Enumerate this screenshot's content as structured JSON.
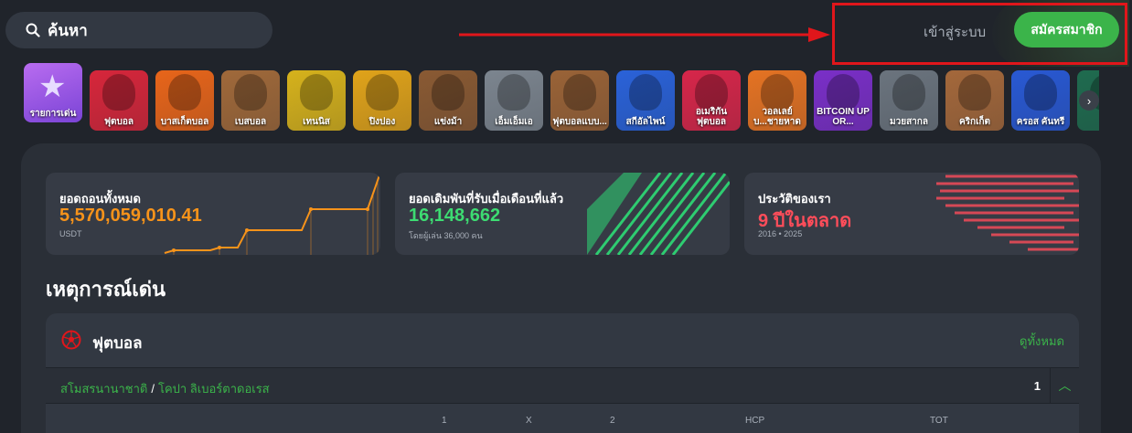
{
  "search": {
    "placeholder": "ค้นหา"
  },
  "auth": {
    "login": "เข้าสู่ระบบ",
    "signup": "สมัครสมาชิก"
  },
  "colors": {
    "accent": "#3bb44a",
    "highlight": "#e0161b",
    "orange": "#f7931a",
    "red": "#ff4d5a"
  },
  "categories": [
    {
      "label": "รายการเด่น",
      "bg": "#9c5ee8"
    },
    {
      "label": "ฟุตบอล",
      "bg": "#d7263b"
    },
    {
      "label": "บาสเก็ตบอล",
      "bg": "#e8651a"
    },
    {
      "label": "เบสบอล",
      "bg": "#a0693a"
    },
    {
      "label": "เทนนิส",
      "bg": "#d6b21c"
    },
    {
      "label": "ปิงปอง",
      "bg": "#e0a31a"
    },
    {
      "label": "แข่งม้า",
      "bg": "#8a5a33"
    },
    {
      "label": "เอ็มเอ็มเอ",
      "bg": "#7c858f"
    },
    {
      "label": "ฟุตบอลแบบ...",
      "bg": "#9a6337"
    },
    {
      "label": "สกีอัลไพน์",
      "bg": "#2a62d9"
    },
    {
      "label": "อเมริกันฟุตบอล",
      "bg": "#d7264a"
    },
    {
      "label": "วอลเลย์บ...ชายหาด",
      "bg": "#e57323"
    },
    {
      "label": "BITCOIN UP OR...",
      "bg": "#7a2fc8"
    },
    {
      "label": "มวยสากล",
      "bg": "#6b747e"
    },
    {
      "label": "คริกเก็ต",
      "bg": "#a4683b"
    },
    {
      "label": "ครอส คันทรี",
      "bg": "#2959d4"
    },
    {
      "label": "",
      "bg": "#1f6b4f"
    }
  ],
  "stats": [
    {
      "title": "ยอดถอนทั้งหมด",
      "value": "5,570,059,010.41",
      "sub": "USDT"
    },
    {
      "title": "ยอดเดิมพันที่รับเมื่อเดือนที่แล้ว",
      "value": "16,148,662",
      "sub": "โดยผู้เล่น 36,000 คน"
    },
    {
      "title": "ประวัติของเรา",
      "value": "9 ปีในตลาด",
      "sub": "2016 • 2025"
    }
  ],
  "section": {
    "title": "เหตุการณ์เด่น"
  },
  "sport_card": {
    "title": "ฟุตบอล",
    "see_all": "ดูทั้งหมด",
    "league_country": "สโมสรนานาชาติ",
    "league_separator": "/",
    "league_name": "โคปา ลิเบอร์ตาดอเรส",
    "count": "1",
    "columns": [
      "1",
      "X",
      "2",
      "HCP",
      "TOT"
    ]
  }
}
